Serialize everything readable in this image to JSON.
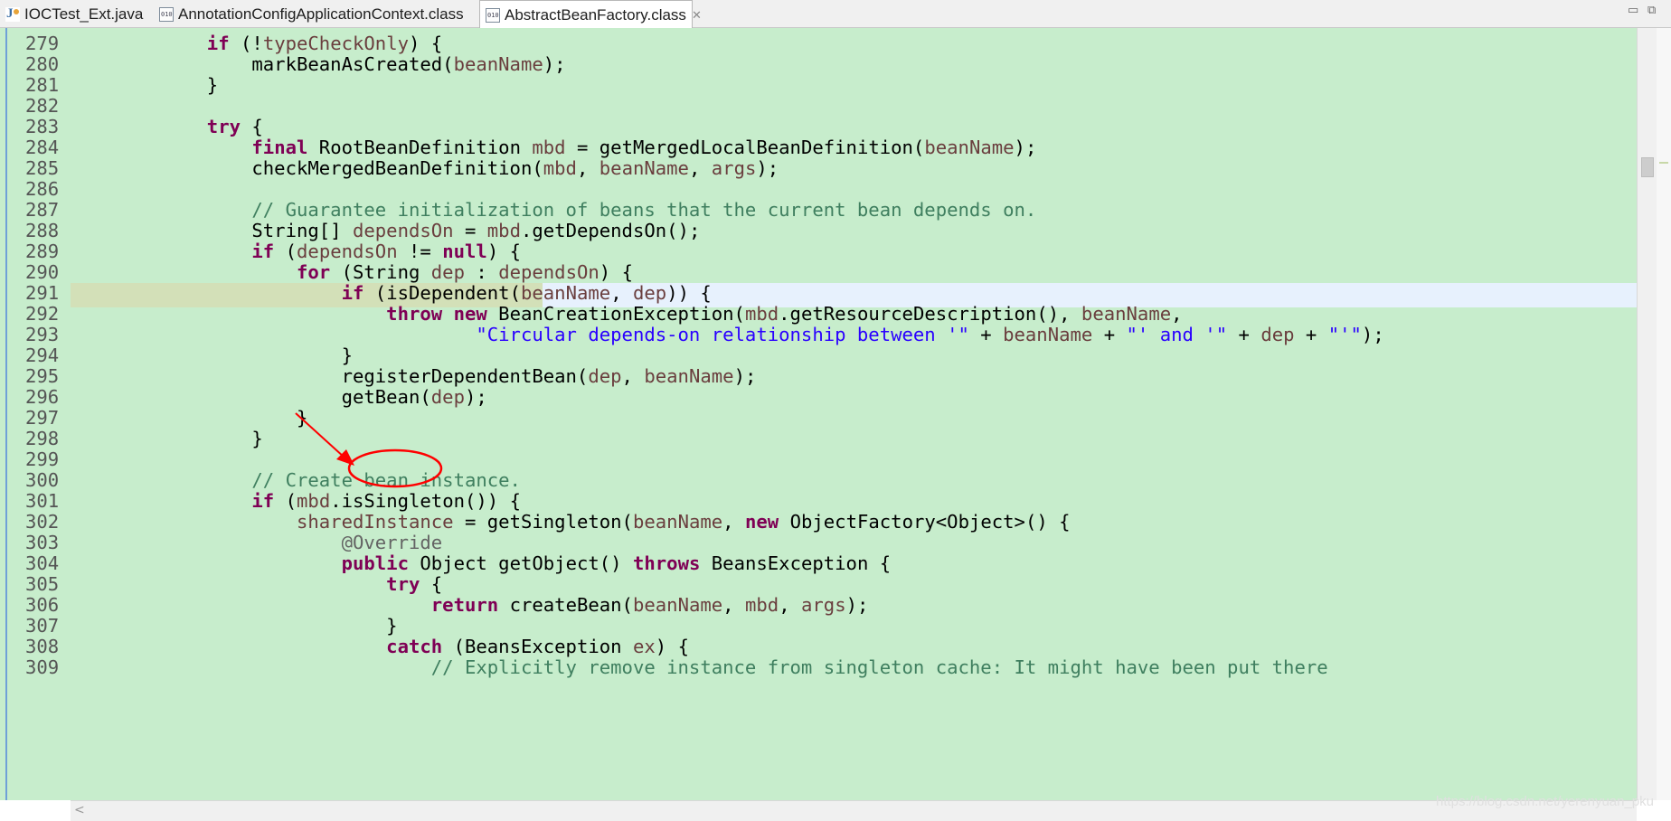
{
  "tabs": [
    {
      "label": "IOCTest_Ext.java",
      "icon": "java-file-icon",
      "active": false
    },
    {
      "label": "AnnotationConfigApplicationContext.class",
      "icon": "class-file-icon",
      "active": false
    },
    {
      "label": "AbstractBeanFactory.class",
      "icon": "class-file-icon",
      "active": true
    }
  ],
  "window_controls": {
    "minimize": "▭",
    "maximize": "⧉"
  },
  "editor": {
    "current_line": "289",
    "lines": [
      {
        "n": "279",
        "t": "            if (!typeCheckOnly) {"
      },
      {
        "n": "280",
        "t": "                markBeanAsCreated(beanName);"
      },
      {
        "n": "281",
        "t": "            }"
      },
      {
        "n": "282",
        "t": ""
      },
      {
        "n": "283",
        "t": "            try {"
      },
      {
        "n": "284",
        "t": "                final RootBeanDefinition mbd = getMergedLocalBeanDefinition(beanName);"
      },
      {
        "n": "285",
        "t": "                checkMergedBeanDefinition(mbd, beanName, args);"
      },
      {
        "n": "286",
        "t": ""
      },
      {
        "n": "287",
        "t": "                // Guarantee initialization of beans that the current bean depends on."
      },
      {
        "n": "288",
        "t": "                String[] dependsOn = mbd.getDependsOn();"
      },
      {
        "n": "289",
        "t": "                if (dependsOn != null) {"
      },
      {
        "n": "290",
        "t": "                    for (String dep : dependsOn) {"
      },
      {
        "n": "291",
        "t": "                        if (isDependent(beanName, dep)) {"
      },
      {
        "n": "292",
        "t": "                            throw new BeanCreationException(mbd.getResourceDescription(), beanName,"
      },
      {
        "n": "293",
        "t": "                                    \"Circular depends-on relationship between '\" + beanName + \"' and '\" + dep + \"'\");"
      },
      {
        "n": "294",
        "t": "                        }"
      },
      {
        "n": "295",
        "t": "                        registerDependentBean(dep, beanName);"
      },
      {
        "n": "296",
        "t": "                        getBean(dep);"
      },
      {
        "n": "297",
        "t": "                    }"
      },
      {
        "n": "298",
        "t": "                }"
      },
      {
        "n": "299",
        "t": ""
      },
      {
        "n": "300",
        "t": "                // Create bean instance."
      },
      {
        "n": "301",
        "t": "                if (mbd.isSingleton()) {"
      },
      {
        "n": "302",
        "t": "                    sharedInstance = getSingleton(beanName, new ObjectFactory<Object>() {"
      },
      {
        "n": "303",
        "t": "                        @Override"
      },
      {
        "n": "304",
        "t": "                        public Object getObject() throws BeansException {"
      },
      {
        "n": "305",
        "t": "                            try {"
      },
      {
        "n": "306",
        "t": "                                return createBean(beanName, mbd, args);"
      },
      {
        "n": "307",
        "t": "                            }"
      },
      {
        "n": "308",
        "t": "                            catch (BeansException ex) {"
      },
      {
        "n": "309",
        "t": "                                // Explicitly remove instance from singleton cache: It might have been put there"
      }
    ]
  },
  "watermark": "https://blog.csdn.net/yerenyuan_pku",
  "annotation": {
    "color": "#ff0000",
    "target": "getBean"
  }
}
